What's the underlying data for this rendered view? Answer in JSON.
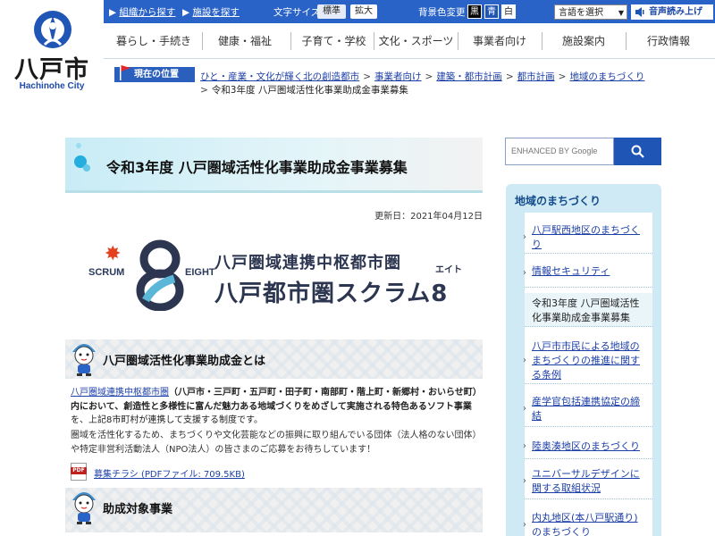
{
  "site": {
    "logo_text": "八戸市",
    "logo_sub": "Hachinohe City"
  },
  "utility": {
    "org_search": "組織から探す",
    "facility_search": "施設を探す",
    "font_size_label": "文字サイズ",
    "font_standard": "標準",
    "font_large": "拡大",
    "bg_color_label": "背景色変更",
    "bg_black": "黒",
    "bg_blue": "青",
    "bg_white": "白",
    "language": "言語を選択",
    "voice": "音声読み上げ"
  },
  "gnav": [
    "暮らし・手続き",
    "健康・福祉",
    "子育て・学校",
    "文化・スポーツ",
    "事業者向け",
    "施設案内",
    "行政情報"
  ],
  "breadcrumb": {
    "label": "現在の位置",
    "items": [
      "ひと・産業・文化が輝く北の創造都市",
      "事業者向け",
      "建築・都市計画",
      "都市計画",
      "地域のまちづくり"
    ],
    "current": "令和3年度 八戸圏域活性化事業助成金事業募集"
  },
  "page": {
    "title": "令和3年度 八戸圏域活性化事業助成金事業募集",
    "updated": "更新日：2021年04月12日"
  },
  "banner": {
    "scrum": "SCRUM",
    "eight": "EIGHT",
    "line1": "八戸圏域連携中枢都市圏",
    "line2": "八戸都市圏スクラム8",
    "eito": "エイト"
  },
  "section1": {
    "heading": "八戸圏域活性化事業助成金とは",
    "link": "八戸圏域連携中枢都市圏",
    "bold_text": "（八戸市・三戸町・五戸町・田子町・南部町・階上町・新郷村・おいらせ町）内において、創造性と多様性に富んだ魅力ある地域づくりをめざして実施される特色あるソフト事業",
    "tail_text": "を、上記8市町村が連携して支援する制度です。",
    "para2": "圏域を活性化するため、まちづくりや文化芸能などの振興に取り組んでいる団体（法人格のない団体）や特定非営利活動法人（NPO法人）の皆さまのご応募をお待ちしています！",
    "pdf_badge": "PDF",
    "pdf_link": "募集チラシ (PDFファイル: 709.5KB)"
  },
  "section2": {
    "heading": "助成対象事業"
  },
  "search": {
    "placeholder": "ENHANCED BY Google"
  },
  "sidebar": {
    "title": "地域のまちづくり",
    "items": [
      {
        "label": "八戸駅西地区のまちづくり",
        "current": false
      },
      {
        "label": "情報セキュリティ",
        "current": false
      },
      {
        "label": "令和3年度 八戸圏域活性化事業助成金事業募集",
        "current": true
      },
      {
        "label": "八戸市市民による地域のまちづくりの推進に関する条例",
        "current": false
      },
      {
        "label": "産学官包括連携協定の締結",
        "current": false
      },
      {
        "label": "陸奥湊地区のまちづくり",
        "current": false
      },
      {
        "label": "ユニバーサルデザインに関する取組状況",
        "current": false
      },
      {
        "label": "内丸地区(本八戸駅通り)のまちづくり",
        "current": false
      }
    ]
  },
  "colors": {
    "brand_blue": "#2a63c7",
    "link": "#1c3fa8",
    "sidebar_bg": "#cfeaf5"
  }
}
